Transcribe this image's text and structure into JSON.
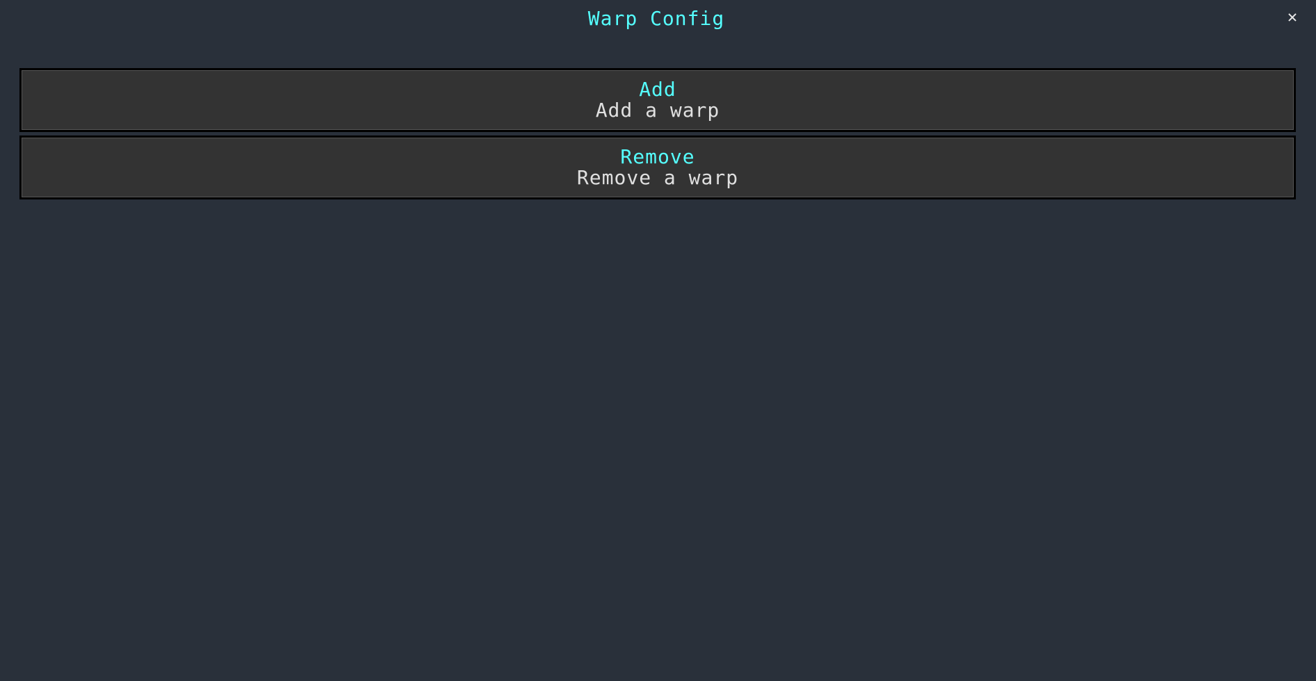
{
  "screen": {
    "title": "Warp Config",
    "close_glyph": "✕",
    "close_icon": "close-icon"
  },
  "entries": [
    {
      "title": "Add",
      "description": "Add a warp"
    },
    {
      "title": "Remove",
      "description": "Remove a warp"
    }
  ],
  "colors": {
    "background": "#29303a",
    "title": "#55ffff",
    "button_bg": "#333333",
    "button_border": "#000000",
    "description": "#e0e0e0"
  }
}
